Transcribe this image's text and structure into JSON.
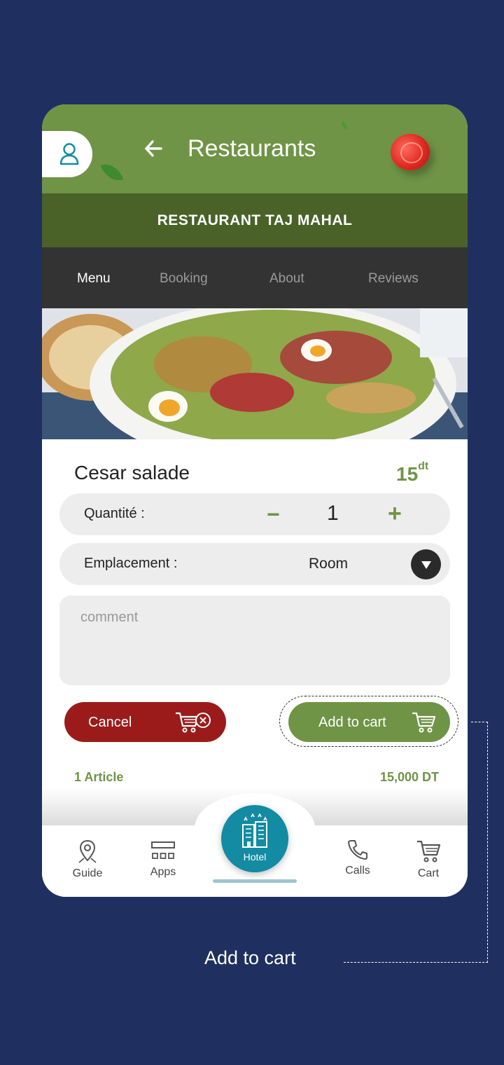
{
  "header": {
    "title": "Restaurants",
    "restaurant_name": "RESTAURANT TAJ MAHAL",
    "accent_color": "#6f9446"
  },
  "tabs": [
    {
      "label": "Menu",
      "active": true
    },
    {
      "label": "Booking",
      "active": false
    },
    {
      "label": "About",
      "active": false
    },
    {
      "label": "Reviews",
      "active": false
    }
  ],
  "item": {
    "name": "Cesar salade",
    "price": "15",
    "price_unit": "dt"
  },
  "quantity": {
    "label": "Quantité :",
    "minus": "−",
    "value": "1",
    "plus": "+"
  },
  "placement": {
    "label": "Emplacement :",
    "value": "Room"
  },
  "comment": {
    "placeholder": "comment",
    "value": ""
  },
  "actions": {
    "cancel_label": "Cancel",
    "add_label": "Add to cart",
    "cancel_color": "#9b1b1b"
  },
  "summary": {
    "count": "1 Article",
    "total": "15,000 DT"
  },
  "nav": {
    "guide": "Guide",
    "apps": "Apps",
    "hotel": "Hotel",
    "calls": "Calls",
    "cart": "Cart",
    "hotel_color": "#128ba3"
  },
  "annotation": {
    "label": "Add to cart"
  }
}
